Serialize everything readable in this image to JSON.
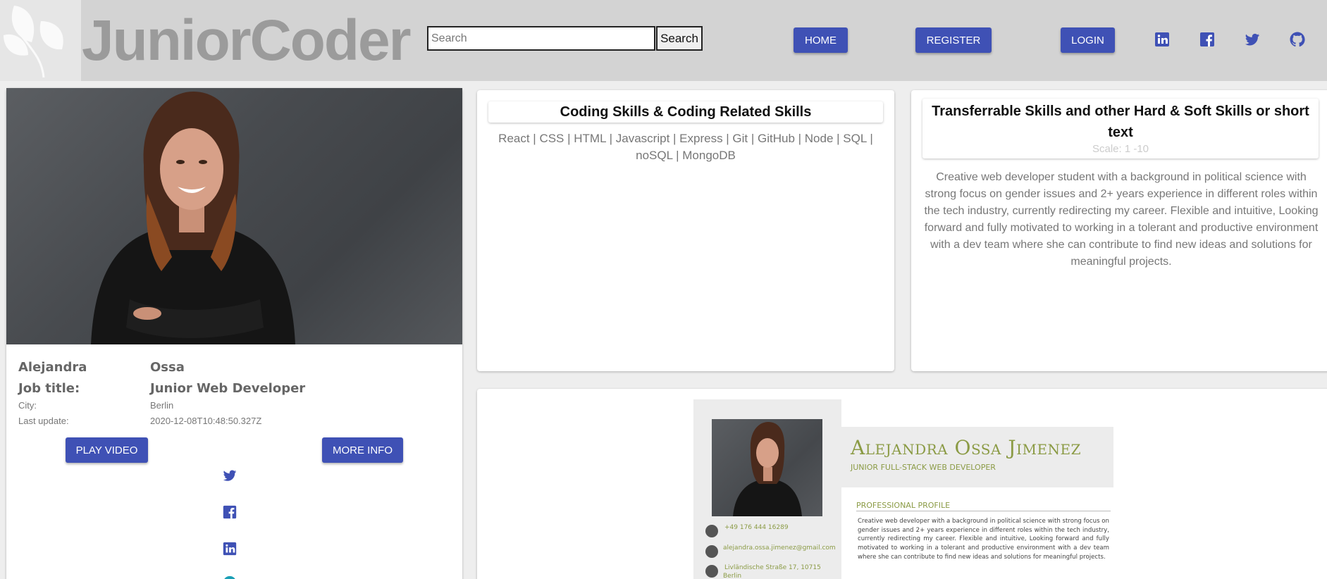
{
  "header": {
    "logo_text": "JuniorCoder",
    "search": {
      "placeholder": "Search",
      "button_label": "Search"
    },
    "nav": {
      "home": "HOME",
      "register": "REGISTER",
      "login": "LOGIN"
    },
    "social_icons": [
      "linkedin-icon",
      "facebook-icon",
      "twitter-icon",
      "github-icon"
    ],
    "colors": {
      "background": "#d3d3d3",
      "accent": "#3f51b5",
      "logo": "#9b9b9b"
    }
  },
  "profile": {
    "first_name": "Alejandra",
    "last_name": "Ossa",
    "job_title_label": "Job title:",
    "job_title": "Junior Web Developer",
    "city_label": "City:",
    "city": "Berlin",
    "last_update_label": "Last update:",
    "last_update": "2020-12-08T10:48:50.327Z",
    "play_video_label": "PLAY VIDEO",
    "more_info_label": "MORE INFO",
    "social_icons": [
      "twitter-icon",
      "facebook-icon",
      "linkedin-icon"
    ]
  },
  "coding_skills": {
    "title": "Coding Skills & Coding Related Skills",
    "text": "React | CSS | HTML | Javascript | Express | Git | GitHub | Node | SQL | noSQL | MongoDB"
  },
  "transferrable_skills": {
    "title": "Transferrable Skills and other Hard & Soft Skills or short text",
    "scale": "Scale: 1 -10",
    "text": "Creative web developer student with a background in political science with strong focus on gender issues and 2+ years experience in different roles within the tech industry, currently redirecting my career. Flexible and intuitive, Looking forward and fully motivated to working in a tolerant and productive environment with a dev team where she can contribute to find new ideas and solutions for meaningful projects."
  },
  "cv": {
    "name": "Alejandra Ossa  Jimenez",
    "role": "JUNIOR FULL-STACK WEB DEVELOPER",
    "section_title": "PROFESSIONAL PROFILE",
    "profile_text": "Creative web developer with a background in political science with strong focus on gender issues and 2+ years  experience in different roles within the tech industry, currently redirecting my career. Flexible and intuitive, Looking forward and fully motivated to working in a tolerant and productive environment with a dev team where she can contribute to find new ideas and solutions for meaningful projects.",
    "phone": "+49 176 444 16289",
    "email": "alejandra.ossa.jimenez@gmail.com",
    "address_line1": "Livländische Straße 17, 10715",
    "address_line2": "Berlin",
    "accent_color": "#8b9b45"
  }
}
